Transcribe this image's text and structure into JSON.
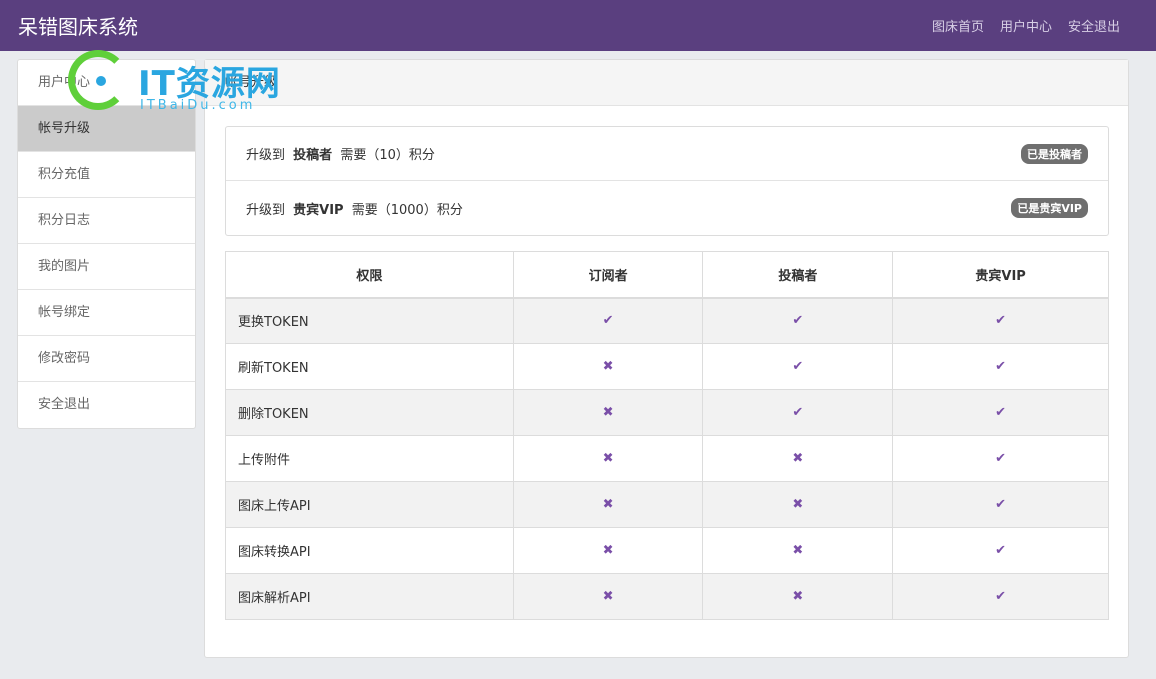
{
  "header": {
    "title": "呆错图床系统",
    "nav": [
      "图床首页",
      "用户中心",
      "安全退出"
    ]
  },
  "sidebar": {
    "items": [
      {
        "label": "用户中心",
        "active": false
      },
      {
        "label": "帐号升级",
        "active": true
      },
      {
        "label": "积分充值",
        "active": false
      },
      {
        "label": "积分日志",
        "active": false
      },
      {
        "label": "我的图片",
        "active": false
      },
      {
        "label": "帐号绑定",
        "active": false
      },
      {
        "label": "修改密码",
        "active": false
      },
      {
        "label": "安全退出",
        "active": false
      }
    ]
  },
  "panel": {
    "title": "帐号升级"
  },
  "upgrades": [
    {
      "prefix": "升级到",
      "role": "投稿者",
      "need": "需要（10）积分",
      "badge": "已是投稿者"
    },
    {
      "prefix": "升级到",
      "role": "贵宾VIP",
      "need": "需要（1000）积分",
      "badge": "已是贵宾VIP"
    }
  ],
  "table": {
    "headers": [
      "权限",
      "订阅者",
      "投稿者",
      "贵宾VIP"
    ],
    "rows": [
      {
        "name": "更换TOKEN",
        "marks": [
          "✔",
          "✔",
          "✔"
        ]
      },
      {
        "name": "刷新TOKEN",
        "marks": [
          "✖",
          "✔",
          "✔"
        ]
      },
      {
        "name": "删除TOKEN",
        "marks": [
          "✖",
          "✔",
          "✔"
        ]
      },
      {
        "name": "上传附件",
        "marks": [
          "✖",
          "✖",
          "✔"
        ]
      },
      {
        "name": "图床上传API",
        "marks": [
          "✖",
          "✖",
          "✔"
        ]
      },
      {
        "name": "图床转换API",
        "marks": [
          "✖",
          "✖",
          "✔"
        ]
      },
      {
        "name": "图床解析API",
        "marks": [
          "✖",
          "✖",
          "✔"
        ]
      }
    ]
  },
  "watermark": {
    "text": "IT资源网",
    "sub": "ITBaiDu.com"
  },
  "colors": {
    "header_bg": "#5a3f7f",
    "mark": "#7a4fa8",
    "badge_bg": "#6f6f6f"
  }
}
